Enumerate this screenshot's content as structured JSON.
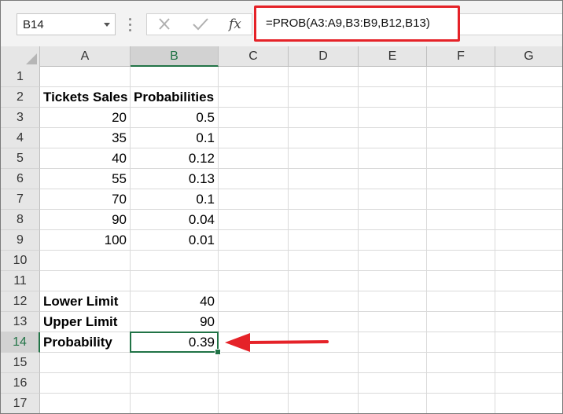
{
  "namebox": {
    "value": "B14"
  },
  "formula_bar": {
    "cancel_icon": "close-icon",
    "enter_icon": "check-icon",
    "fx_label": "fx",
    "formula": "=PROB(A3:A9,B3:B9,B12,B13)"
  },
  "columns": [
    "A",
    "B",
    "C",
    "D",
    "E",
    "F",
    "G"
  ],
  "selected_column": "B",
  "rows": [
    "1",
    "2",
    "3",
    "4",
    "5",
    "6",
    "7",
    "8",
    "9",
    "10",
    "11",
    "12",
    "13",
    "14",
    "15",
    "16",
    "17"
  ],
  "selected_row": "14",
  "cells": {
    "A2": "Tickets Sales",
    "B2": "Probabilities",
    "A3": "20",
    "B3": "0.5",
    "A4": "35",
    "B4": "0.1",
    "A5": "40",
    "B5": "0.12",
    "A6": "55",
    "B6": "0.13",
    "A7": "70",
    "B7": "0.1",
    "A8": "90",
    "B8": "0.04",
    "A9": "100",
    "B9": "0.01",
    "A12": "Lower Limit",
    "B12": "40",
    "A13": "Upper Limit",
    "B13": "90",
    "A14": "Probability",
    "B14": "0.39"
  },
  "colors": {
    "accent_green": "#217346",
    "highlight_red": "#e52228"
  }
}
